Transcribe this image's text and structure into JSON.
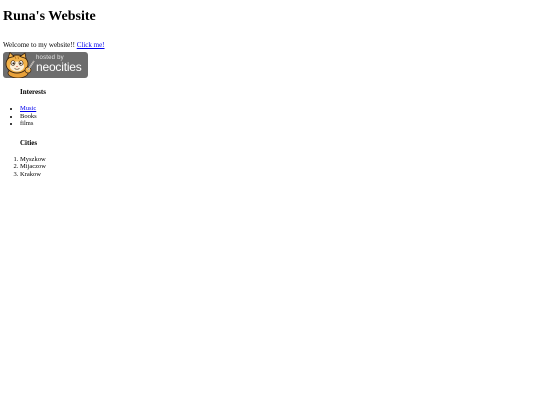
{
  "page": {
    "title": "Runa's Website",
    "welcome_text": "Welcome to my website!!",
    "welcome_link": "Click me!"
  },
  "badge": {
    "small_text": "hosted by",
    "big_text": "neocities",
    "icon": "neocities-cat-icon"
  },
  "interests": {
    "heading": "Interests",
    "items": [
      "Music",
      "Books",
      "films"
    ]
  },
  "cities": {
    "heading": "Cities",
    "items": [
      "Myszkow",
      "Mijaczow",
      "Krakow"
    ]
  },
  "colors": {
    "link": "#0000ee",
    "badge_background": "#6d6d6d",
    "background": "#ffffff",
    "text": "#000000"
  }
}
